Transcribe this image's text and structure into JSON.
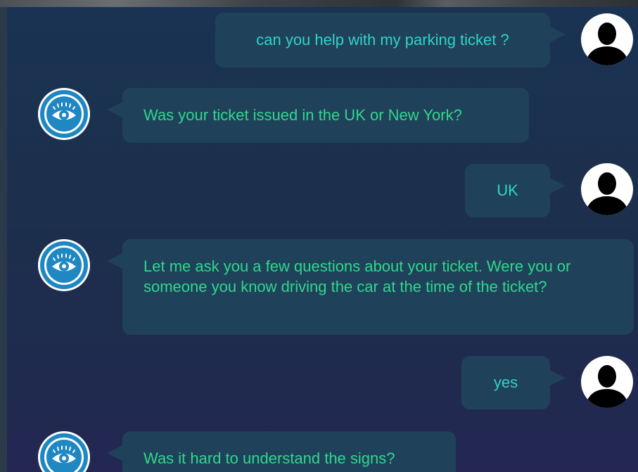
{
  "colors": {
    "panel_bg": "#1c2f4d",
    "bubble_bg": "#20415a",
    "user_text": "#30d4c8",
    "bot_text": "#2ed88c",
    "bot_avatar_blue": "#1f87c2"
  },
  "icons": {
    "user_avatar": "person-silhouette-icon",
    "bot_avatar": "eye-logo-icon"
  },
  "messages": [
    {
      "sender": "user",
      "text": "can you help with my parking ticket ?"
    },
    {
      "sender": "bot",
      "text": "Was your ticket issued in the UK or New York?"
    },
    {
      "sender": "user",
      "text": "UK"
    },
    {
      "sender": "bot",
      "text": "Let me ask you a few questions about your ticket. Were you or someone you know driving the car at the time of the ticket?"
    },
    {
      "sender": "user",
      "text": "yes"
    },
    {
      "sender": "bot",
      "text": "Was it hard to understand the signs?"
    }
  ]
}
